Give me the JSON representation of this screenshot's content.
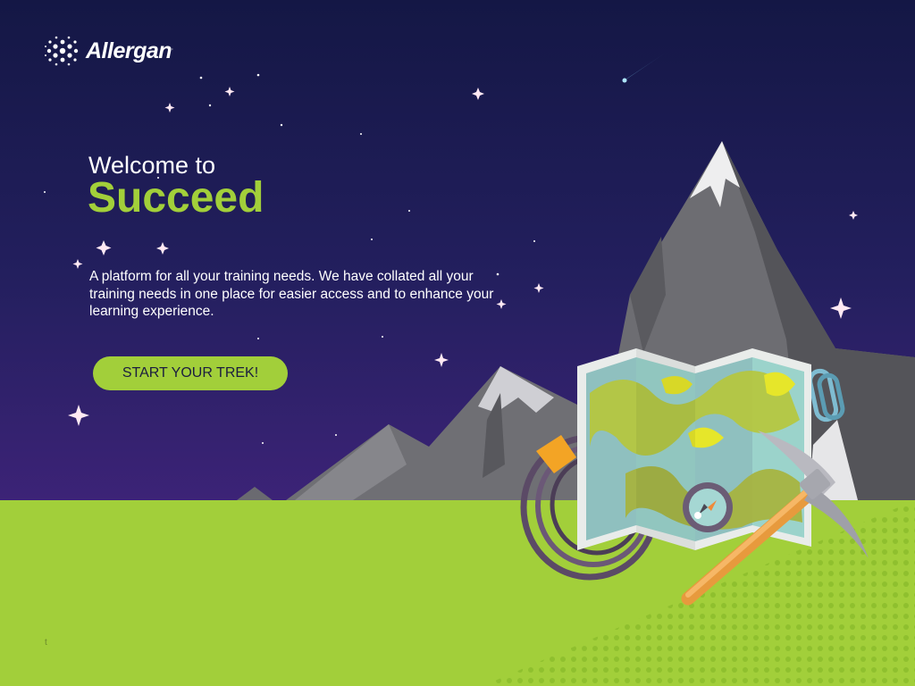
{
  "brand": {
    "logo_text": "Allergan",
    "trademark": "."
  },
  "hero": {
    "welcome_line": "Welcome to",
    "title": "Succeed",
    "description": "A platform for all your training needs. We have collated all your training needs in one place for easier access and to enhance your learning experience.",
    "cta_label": "START YOUR TREK!"
  },
  "footer": {
    "text": "t"
  },
  "colors": {
    "sky_top": "#151847",
    "sky_bottom": "#3a2275",
    "grass": "#a2cf3a",
    "accent_green": "#a2cf3a",
    "button_text": "#1b1d3f"
  }
}
